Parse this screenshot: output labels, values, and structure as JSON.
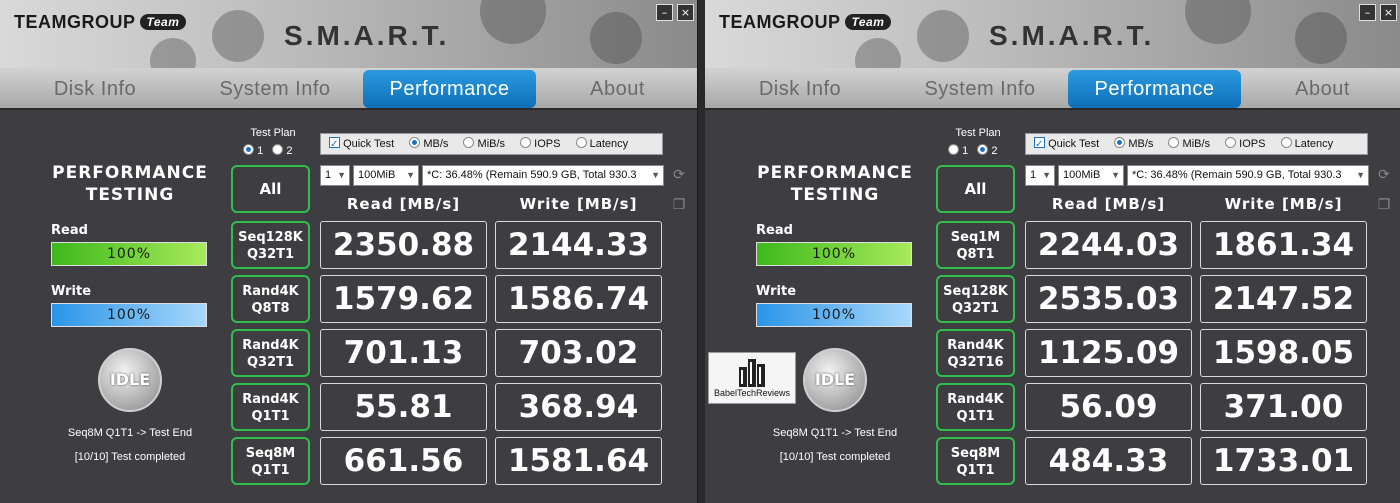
{
  "brand": "TEAMGROUP",
  "brand_badge": "Team",
  "app_title": "S.M.A.R.T.",
  "window_controls": {
    "minimize": "–",
    "close": "×"
  },
  "tabs": [
    "Disk Info",
    "System Info",
    "Performance",
    "About"
  ],
  "active_tab": "Performance",
  "accent_color": "#1a82cf",
  "border_color": "#2fbf4c",
  "watermark_text": "BabelTechReviews",
  "windows": [
    {
      "perf_title": "PERFORMANCE TESTING",
      "read_label": "Read",
      "read_progress": "100%",
      "write_label": "Write",
      "write_progress": "100%",
      "idle_label": "IDLE",
      "status_1": "Seq8M Q1T1 -> Test End",
      "status_2": "[10/10] Test completed",
      "test_plan_label": "Test Plan",
      "plan_options": [
        "1",
        "2"
      ],
      "plan_selected": "1",
      "quick_test_label": "Quick Test",
      "unit_options": [
        "MB/s",
        "MiB/s",
        "IOPS",
        "Latency"
      ],
      "unit_selected": "MB/s",
      "count_value": "1",
      "size_value": "100MiB",
      "drive_value": "*C: 36.48% (Remain 590.9 GB, Total 930.3",
      "all_label": "All",
      "read_header": "Read [MB/s]",
      "write_header": "Write [MB/s]",
      "rows": [
        {
          "l1": "Seq128K",
          "l2": "Q32T1",
          "read": "2350.88",
          "write": "2144.33"
        },
        {
          "l1": "Rand4K",
          "l2": "Q8T8",
          "read": "1579.62",
          "write": "1586.74"
        },
        {
          "l1": "Rand4K",
          "l2": "Q32T1",
          "read": "701.13",
          "write": "703.02"
        },
        {
          "l1": "Rand4K",
          "l2": "Q1T1",
          "read": "55.81",
          "write": "368.94"
        },
        {
          "l1": "Seq8M",
          "l2": "Q1T1",
          "read": "661.56",
          "write": "1581.64"
        }
      ]
    },
    {
      "perf_title": "PERFORMANCE TESTING",
      "read_label": "Read",
      "read_progress": "100%",
      "write_label": "Write",
      "write_progress": "100%",
      "idle_label": "IDLE",
      "status_1": "Seq8M Q1T1 -> Test End",
      "status_2": "[10/10] Test completed",
      "test_plan_label": "Test Plan",
      "plan_options": [
        "1",
        "2"
      ],
      "plan_selected": "2",
      "quick_test_label": "Quick Test",
      "unit_options": [
        "MB/s",
        "MiB/s",
        "IOPS",
        "Latency"
      ],
      "unit_selected": "MB/s",
      "count_value": "1",
      "size_value": "100MiB",
      "drive_value": "*C: 36.48% (Remain 590.9 GB, Total 930.3",
      "all_label": "All",
      "read_header": "Read [MB/s]",
      "write_header": "Write [MB/s]",
      "rows": [
        {
          "l1": "Seq1M",
          "l2": "Q8T1",
          "read": "2244.03",
          "write": "1861.34"
        },
        {
          "l1": "Seq128K",
          "l2": "Q32T1",
          "read": "2535.03",
          "write": "2147.52"
        },
        {
          "l1": "Rand4K",
          "l2": "Q32T16",
          "read": "1125.09",
          "write": "1598.05"
        },
        {
          "l1": "Rand4K",
          "l2": "Q1T1",
          "read": "56.09",
          "write": "371.00"
        },
        {
          "l1": "Seq8M",
          "l2": "Q1T1",
          "read": "484.33",
          "write": "1733.01"
        }
      ]
    }
  ]
}
